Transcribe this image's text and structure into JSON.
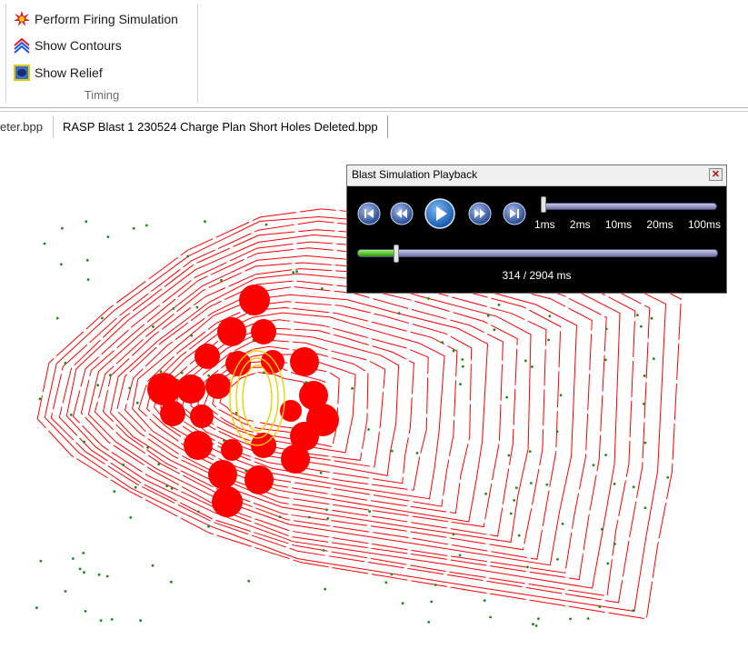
{
  "ribbon": {
    "items": [
      {
        "label": "Perform Firing Simulation",
        "icon": "starburst-icon"
      },
      {
        "label": "Show Contours",
        "icon": "contours-icon"
      },
      {
        "label": "Show Relief",
        "icon": "relief-icon"
      }
    ],
    "group_label": "Timing"
  },
  "tabs": [
    {
      "label": "eter.bpp"
    },
    {
      "label": "RASP Blast 1 230524 Charge Plan Short Holes Deleted.bpp",
      "active": true
    }
  ],
  "player": {
    "title": "Blast Simulation Playback",
    "buttons": [
      "skip-to-start-icon",
      "rewind-icon",
      "play-icon",
      "fast-forward-icon",
      "skip-to-end-icon"
    ],
    "speed_options": [
      "1ms",
      "2ms",
      "10ms",
      "20ms",
      "100ms"
    ],
    "selected_speed": "1ms",
    "current_ms": 314,
    "total_ms": 2904,
    "readout": "314 / 2904 ms"
  },
  "colors": {
    "contour": "#ff0000",
    "charge": "#ff0000",
    "hole_marker": "#1a8a1a",
    "inner_contour": "#f0d000",
    "progress": "#44cc22"
  }
}
